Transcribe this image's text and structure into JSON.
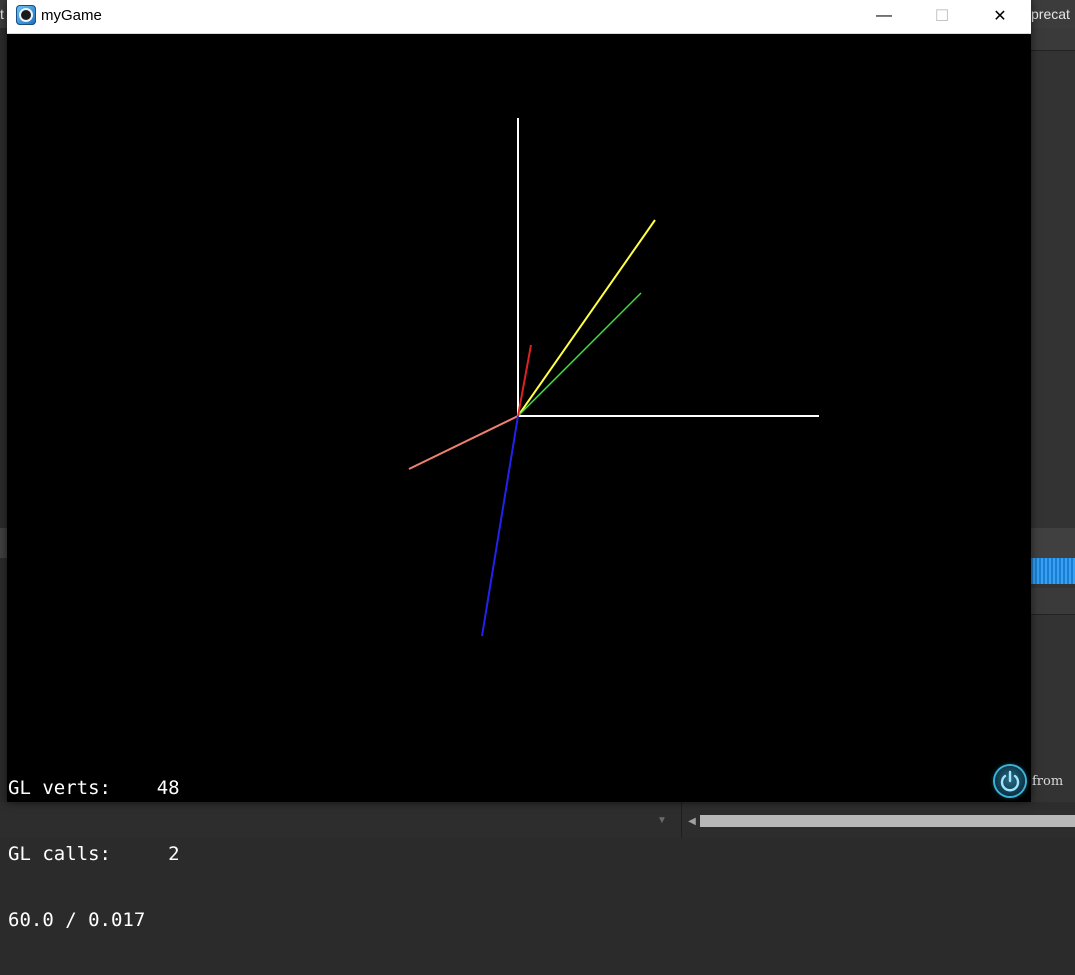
{
  "background_ide": {
    "top_right_text": "precat",
    "top_left_text": "t",
    "dropdown_icon": "chevron-down-icon",
    "scroll_left_icon": "scroll-left-arrow-icon",
    "panel_footer_text": "from"
  },
  "window": {
    "title": "myGame",
    "icon": "app-icon",
    "controls": {
      "minimize_glyph": "—",
      "maximize_glyph": "☐",
      "close_glyph": "✕"
    }
  },
  "scene": {
    "background_color": "#000000",
    "axis_lines": [
      {
        "name": "white-vertical-axis",
        "color": "#ffffff"
      },
      {
        "name": "white-horizontal-axis",
        "color": "#ffffff"
      },
      {
        "name": "yellow-axis",
        "color": "#ffff44"
      },
      {
        "name": "green-axis",
        "color": "#44dd44"
      },
      {
        "name": "red-axis",
        "color": "#dd2222"
      },
      {
        "name": "salmon-axis",
        "color": "#f08070"
      },
      {
        "name": "blue-axis",
        "color": "#2222ee"
      }
    ]
  },
  "stats": {
    "line1": "GL verts:    48",
    "line2": "GL calls:     2",
    "line3": "60.0 / 0.017"
  },
  "power_icon": "power-icon"
}
